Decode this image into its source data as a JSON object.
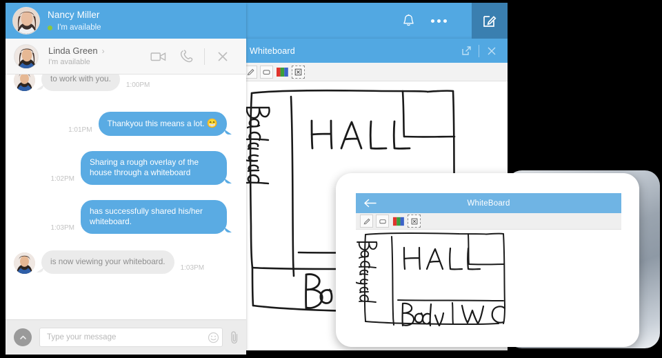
{
  "app": {
    "header": {
      "user_name": "Nancy Miller",
      "user_status": "I'm available",
      "status_color": "#8cc63f",
      "accent_color": "#52a8e2",
      "compose_color": "#3a7fb0",
      "icons": [
        "bell-icon",
        "more-options-icon",
        "compose-icon"
      ]
    },
    "conversation_bar": {
      "contact_name": "Linda Green",
      "contact_status": "I'm available",
      "chevron": "›",
      "actions": [
        "video-call-icon",
        "voice-call-icon",
        "close-icon"
      ]
    },
    "messages": [
      {
        "id": 1,
        "direction": "in",
        "text": "to work with you.",
        "time": "1:00PM",
        "avatar": true,
        "clipped": true
      },
      {
        "id": 2,
        "direction": "out",
        "text": "Thankyou this means a lot.",
        "emoji": "😁",
        "time": "1:01PM"
      },
      {
        "id": 3,
        "direction": "out",
        "text": "Sharing a rough overlay of the house through a whiteboard",
        "time": "1:02PM"
      },
      {
        "id": 4,
        "direction": "out",
        "text": "has successfully shared his/her whiteboard.",
        "time": "1:03PM"
      },
      {
        "id": 5,
        "direction": "in",
        "text": "is now viewing your whiteboard.",
        "time": "1:03PM",
        "avatar": true
      }
    ],
    "composer": {
      "placeholder": "Type your message",
      "value": "",
      "scroll_up_icon": "chevron-up-icon",
      "emoji_icon": "smiley-icon",
      "attach_icon": "paperclip-icon"
    }
  },
  "whiteboard_window": {
    "title": "Whiteboard",
    "header_actions": [
      "popout-icon",
      "close-icon"
    ],
    "toolbar": [
      {
        "name": "pencil-tool",
        "label": "pencil-icon"
      },
      {
        "name": "rectangle-tool",
        "label": "rectangle-icon"
      },
      {
        "name": "color-palette-tool",
        "label": "palette-icon"
      },
      {
        "name": "clear-tool",
        "label": "clear-x-icon"
      }
    ],
    "palette_colors": [
      "#e0342c",
      "#3a9f3a",
      "#3b63c8"
    ],
    "drawing": {
      "type": "floor-plan-sketch",
      "labels": [
        "Backyrd",
        "HALL",
        "Bed",
        "WC"
      ]
    }
  },
  "tablet": {
    "title": "WhiteBoard",
    "back_icon": "arrow-left-icon",
    "accent_color": "#6fb4e4",
    "toolbar": [
      {
        "name": "pencil-tool",
        "label": "pencil-icon"
      },
      {
        "name": "rectangle-tool",
        "label": "rectangle-icon"
      },
      {
        "name": "color-palette-tool",
        "label": "palette-icon"
      },
      {
        "name": "clear-tool",
        "label": "clear-x-icon"
      }
    ],
    "drawing": {
      "type": "floor-plan-sketch",
      "labels": [
        "Backyrd",
        "HALL",
        "Bed",
        "WC"
      ]
    }
  }
}
